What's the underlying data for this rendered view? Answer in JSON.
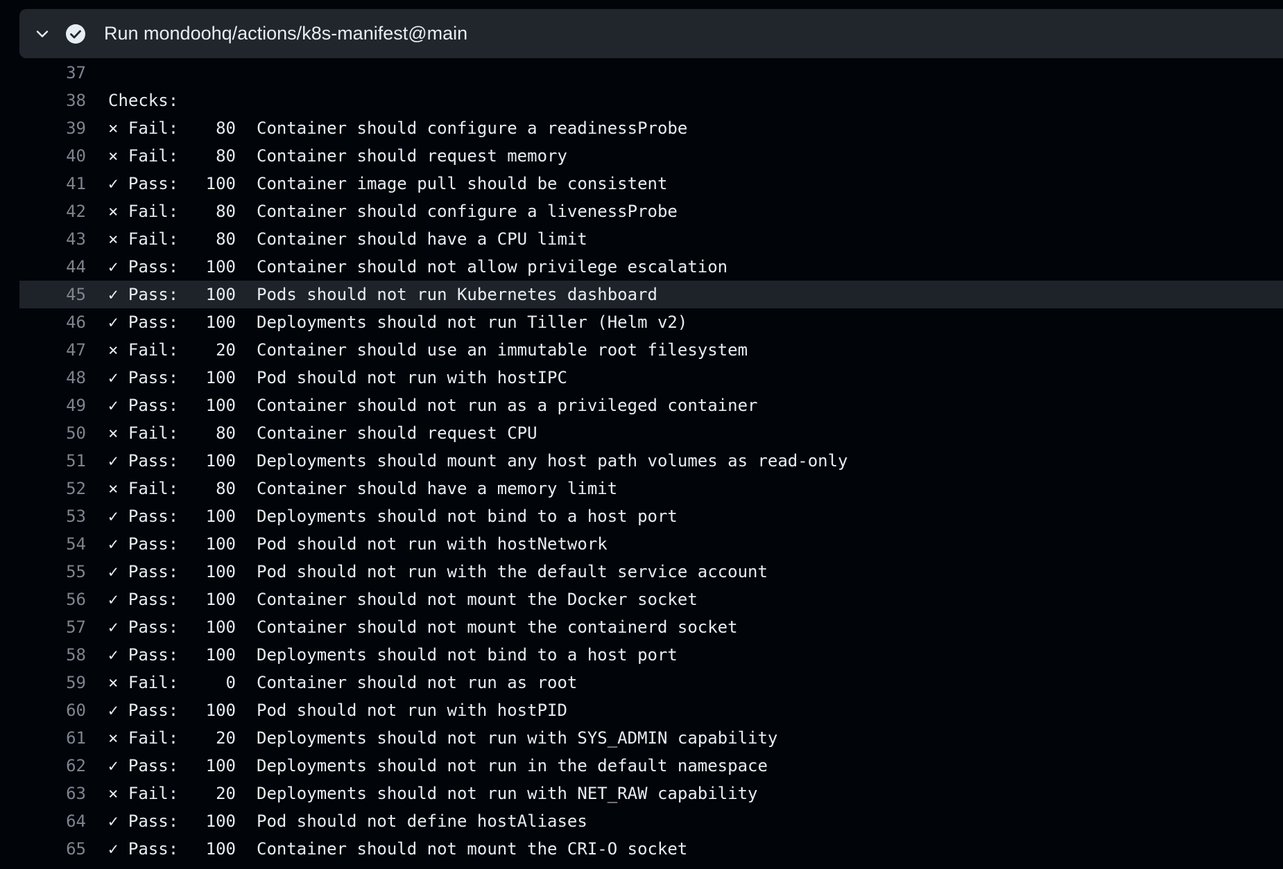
{
  "step": {
    "title": "Run mondoohq/actions/k8s-manifest@main",
    "expanded": true,
    "status": "success"
  },
  "colors": {
    "background": "#010409",
    "header": "#21262d",
    "text": "#e6edf3",
    "line_number": "#7d8590",
    "highlight": "#1e2329"
  },
  "highlighted_line": "45",
  "log": {
    "header_lines": [
      {
        "no": "37",
        "text": ""
      },
      {
        "no": "38",
        "text": "Checks:"
      }
    ],
    "checks": [
      {
        "no": "39",
        "status": "× Fail:",
        "score": "80",
        "text": "Container should configure a readinessProbe"
      },
      {
        "no": "40",
        "status": "× Fail:",
        "score": "80",
        "text": "Container should request memory"
      },
      {
        "no": "41",
        "status": "✓ Pass:",
        "score": "100",
        "text": "Container image pull should be consistent"
      },
      {
        "no": "42",
        "status": "× Fail:",
        "score": "80",
        "text": "Container should configure a livenessProbe"
      },
      {
        "no": "43",
        "status": "× Fail:",
        "score": "80",
        "text": "Container should have a CPU limit"
      },
      {
        "no": "44",
        "status": "✓ Pass:",
        "score": "100",
        "text": "Container should not allow privilege escalation"
      },
      {
        "no": "45",
        "status": "✓ Pass:",
        "score": "100",
        "text": "Pods should not run Kubernetes dashboard"
      },
      {
        "no": "46",
        "status": "✓ Pass:",
        "score": "100",
        "text": "Deployments should not run Tiller (Helm v2)"
      },
      {
        "no": "47",
        "status": "× Fail:",
        "score": "20",
        "text": "Container should use an immutable root filesystem"
      },
      {
        "no": "48",
        "status": "✓ Pass:",
        "score": "100",
        "text": "Pod should not run with hostIPC"
      },
      {
        "no": "49",
        "status": "✓ Pass:",
        "score": "100",
        "text": "Container should not run as a privileged container"
      },
      {
        "no": "50",
        "status": "× Fail:",
        "score": "80",
        "text": "Container should request CPU"
      },
      {
        "no": "51",
        "status": "✓ Pass:",
        "score": "100",
        "text": "Deployments should mount any host path volumes as read-only"
      },
      {
        "no": "52",
        "status": "× Fail:",
        "score": "80",
        "text": "Container should have a memory limit"
      },
      {
        "no": "53",
        "status": "✓ Pass:",
        "score": "100",
        "text": "Deployments should not bind to a host port"
      },
      {
        "no": "54",
        "status": "✓ Pass:",
        "score": "100",
        "text": "Pod should not run with hostNetwork"
      },
      {
        "no": "55",
        "status": "✓ Pass:",
        "score": "100",
        "text": "Pod should not run with the default service account"
      },
      {
        "no": "56",
        "status": "✓ Pass:",
        "score": "100",
        "text": "Container should not mount the Docker socket"
      },
      {
        "no": "57",
        "status": "✓ Pass:",
        "score": "100",
        "text": "Container should not mount the containerd socket"
      },
      {
        "no": "58",
        "status": "✓ Pass:",
        "score": "100",
        "text": "Deployments should not bind to a host port"
      },
      {
        "no": "59",
        "status": "× Fail:",
        "score": "0",
        "text": "Container should not run as root"
      },
      {
        "no": "60",
        "status": "✓ Pass:",
        "score": "100",
        "text": "Pod should not run with hostPID"
      },
      {
        "no": "61",
        "status": "× Fail:",
        "score": "20",
        "text": "Deployments should not run with SYS_ADMIN capability"
      },
      {
        "no": "62",
        "status": "✓ Pass:",
        "score": "100",
        "text": "Deployments should not run in the default namespace"
      },
      {
        "no": "63",
        "status": "× Fail:",
        "score": "20",
        "text": "Deployments should not run with NET_RAW capability"
      },
      {
        "no": "64",
        "status": "✓ Pass:",
        "score": "100",
        "text": "Pod should not define hostAliases"
      },
      {
        "no": "65",
        "status": "✓ Pass:",
        "score": "100",
        "text": "Container should not mount the CRI-O socket"
      }
    ]
  }
}
